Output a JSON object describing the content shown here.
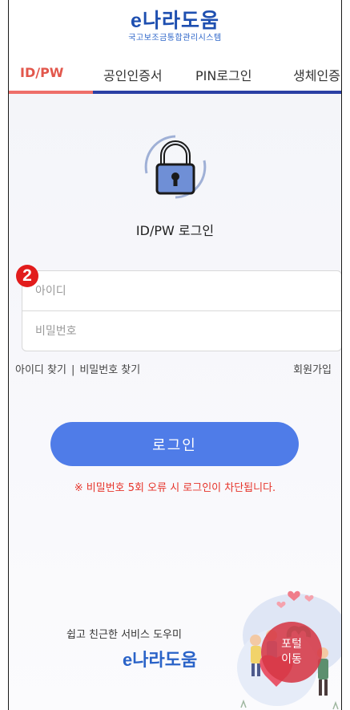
{
  "header": {
    "logo_main": "e나라도움",
    "logo_sub": "국고보조금통합관리시스템"
  },
  "tabs": [
    {
      "label": "ID/PW",
      "active": true
    },
    {
      "label": "공인인증서",
      "active": false
    },
    {
      "label": "PIN로그인",
      "active": false
    },
    {
      "label": "생체인증",
      "active": false
    }
  ],
  "login": {
    "icon": "lock-icon",
    "title": "ID/PW 로그인",
    "id_placeholder": "아이디",
    "pw_placeholder": "비밀번호",
    "find_id": "아이디 찾기",
    "separator": "|",
    "find_pw": "비밀번호 찾기",
    "signup": "회원가입",
    "button": "로그인",
    "warning": "※ 비밀번호 5회 오류 시 로그인이 차단됩니다."
  },
  "annotation": {
    "number": "2",
    "color": "#e21c1c"
  },
  "helper": {
    "subtitle": "쉽고 친근한 서비스 도우미",
    "logo": "e나라도움"
  },
  "portal": {
    "line1": "포털",
    "line2": "이동"
  },
  "colors": {
    "accent_red": "#e2574c",
    "tab_blue": "#2a3fa4",
    "button_blue": "#4f7ce8",
    "warning_red": "#e6342b",
    "lock_blue": "#6f8fd6"
  }
}
